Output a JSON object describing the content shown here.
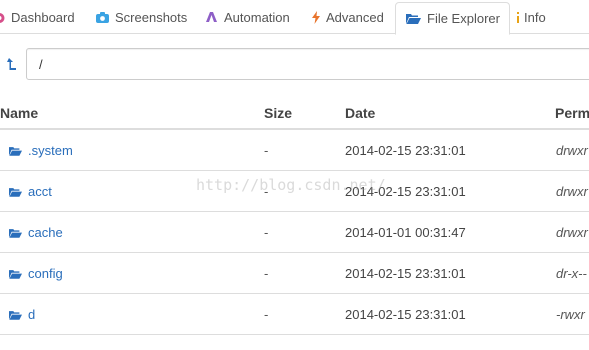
{
  "tabs": [
    {
      "label": "Dashboard",
      "icon": "dashboard-icon",
      "color": "#d64f8a"
    },
    {
      "label": "Screenshots",
      "icon": "camera-icon",
      "color": "#3aa3e3"
    },
    {
      "label": "Automation",
      "icon": "automation-icon",
      "color": "#8e5fc7"
    },
    {
      "label": "Advanced",
      "icon": "bolt-icon",
      "color": "#e8742c"
    },
    {
      "label": "File Explorer",
      "icon": "folder-open-icon",
      "color": "#2a6ebb"
    },
    {
      "label": "Info",
      "icon": "info-icon",
      "color": "#e8a317"
    }
  ],
  "active_tab": "File Explorer",
  "path": {
    "value": "/"
  },
  "table": {
    "headers": {
      "name": "Name",
      "size": "Size",
      "date": "Date",
      "permissions": "Permi"
    },
    "rows": [
      {
        "name": ".system",
        "size": "-",
        "date": "2014-02-15 23:31:01",
        "perm": "drwxr"
      },
      {
        "name": "acct",
        "size": "-",
        "date": "2014-02-15 23:31:01",
        "perm": "drwxr"
      },
      {
        "name": "cache",
        "size": "-",
        "date": "2014-01-01 00:31:47",
        "perm": "drwxr"
      },
      {
        "name": "config",
        "size": "-",
        "date": "2014-02-15 23:31:01",
        "perm": "dr-x--"
      },
      {
        "name": "d",
        "size": "-",
        "date": "2014-02-15 23:31:01",
        "perm": "-rwxr"
      }
    ]
  },
  "watermark": "http://blog.csdn.net/",
  "colors": {
    "link": "#2a6ebb",
    "border": "#dddddd"
  }
}
